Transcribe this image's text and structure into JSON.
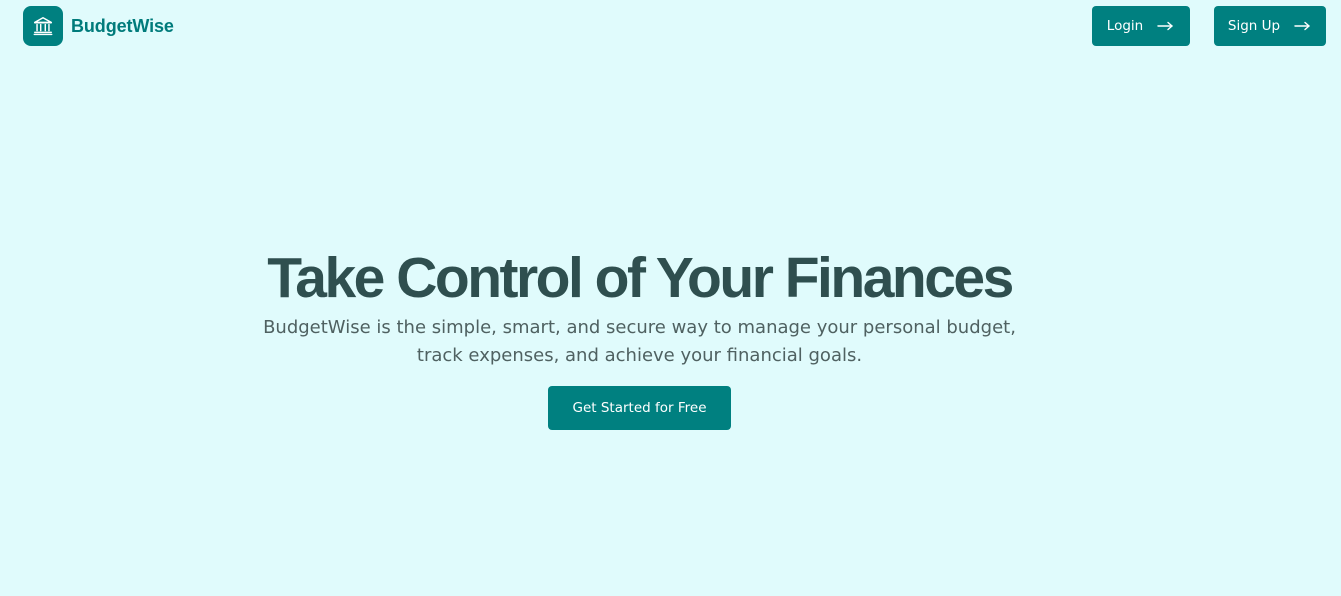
{
  "brand": {
    "name": "BudgetWise",
    "icon": "bank-icon"
  },
  "nav": {
    "login_label": "Login",
    "signup_label": "Sign Up",
    "arrow_icon": "arrow-right-icon"
  },
  "hero": {
    "title": "Take Control of Your Finances",
    "subtitle_line1": "BudgetWise is the simple, smart, and secure way to manage your personal budget,",
    "subtitle_line2": "track expenses, and achieve your financial goals.",
    "cta_label": "Get Started for Free"
  },
  "colors": {
    "background": "#e0fbfc",
    "accent": "#008080",
    "title": "#2f4f4f",
    "text": "#4f6161"
  }
}
